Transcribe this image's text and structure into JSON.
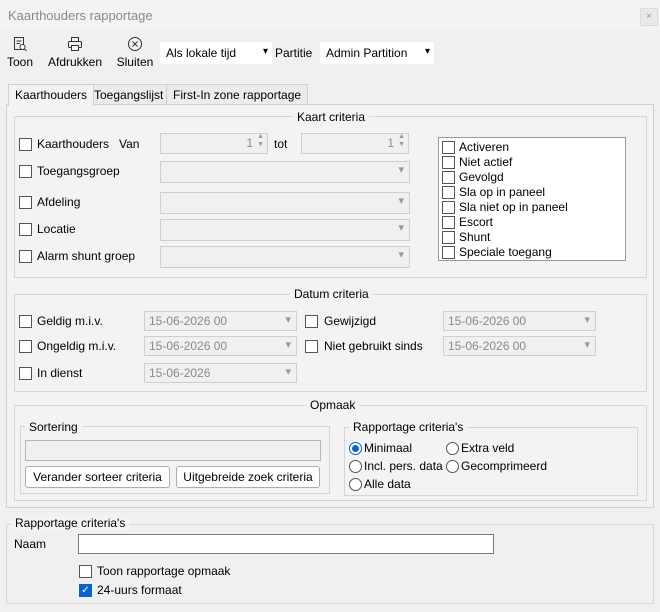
{
  "window": {
    "title": "Kaarthouders rapportage",
    "close_icon_glyph": "×"
  },
  "toolbar": {
    "show_label": "Toon",
    "print_label": "Afdrukken",
    "close_label": "Sluiten",
    "time_mode": "Als lokale tijd",
    "partition_label": "Partitie",
    "partition_value": "Admin Partition"
  },
  "tabs": [
    "Kaarthouders",
    "Toegangslijst",
    "First-In zone rapportage"
  ],
  "card_criteria": {
    "legend": "Kaart criteria",
    "cardholders": "Kaarthouders",
    "from": "Van",
    "from_value": "1",
    "to": "tot",
    "to_value": "1",
    "access_group": "Toegangsgroep",
    "department": "Afdeling",
    "location": "Locatie",
    "alarm_shunt_group": "Alarm shunt groep",
    "options": [
      "Activeren",
      "Niet actief",
      "Gevolgd",
      "Sla op in paneel",
      "Sla niet op in paneel",
      "Escort",
      "Shunt",
      "Speciale toegang"
    ]
  },
  "date_criteria": {
    "legend": "Datum criteria",
    "valid_from": "Geldig m.i.v.",
    "valid_from_value": "15-06-2026 00",
    "invalid_from": "Ongeldig m.i.v.",
    "invalid_from_value": "15-06-2026 00",
    "in_service": "In dienst",
    "in_service_value": "15-06-2026",
    "modified": "Gewijzigd",
    "modified_value": "15-06-2026 00",
    "not_used_since": "Niet gebruikt sinds",
    "not_used_since_value": "15-06-2026 00"
  },
  "layout_group": {
    "legend": "Opmaak",
    "sorting": "Sortering",
    "change_sort": "Verander sorteer criteria",
    "advanced_search": "Uitgebreide zoek criteria",
    "report_criteria": "Rapportage criteria's",
    "radio": {
      "minimal": "Minimaal",
      "extra_field": "Extra veld",
      "incl_personal": "Incl. pers. data",
      "compressed": "Gecomprimeerd",
      "all_data": "Alle data"
    },
    "selected": "minimal"
  },
  "report_criteria": {
    "legend": "Rapportage criteria's",
    "name_label": "Naam",
    "name_value": "",
    "show_layout": "Toon rapportage opmaak",
    "show_layout_checked": false,
    "format_24h": "24-uurs formaat",
    "format_24h_checked": true
  },
  "icons": {
    "show": "report-view-icon",
    "print": "printer-icon",
    "close": "close-circle-icon",
    "check": "✓",
    "dropdown": "▾"
  }
}
